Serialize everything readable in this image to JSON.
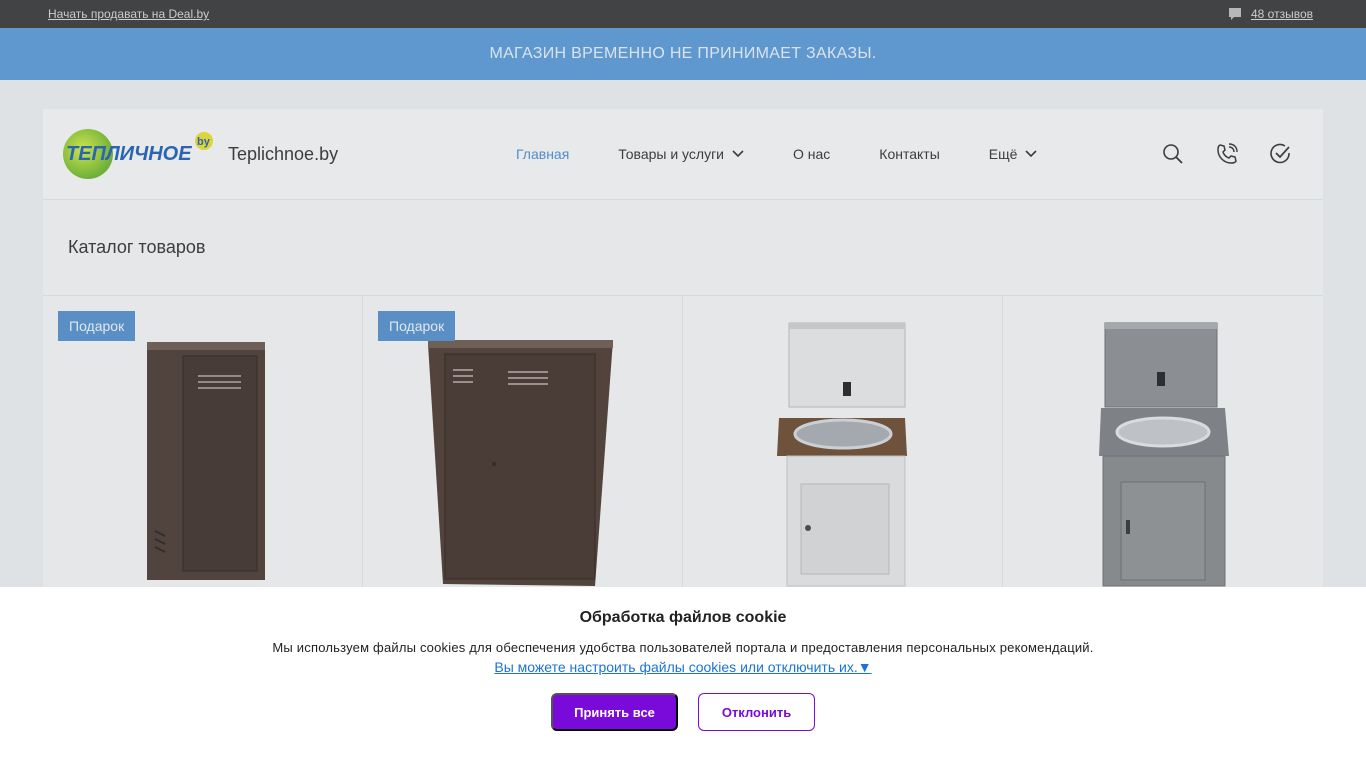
{
  "topbar": {
    "sell_link": "Начать продавать на Deal.by",
    "reviews": "48 отзывов",
    "reviews_icon": "comment-icon"
  },
  "notice": {
    "text": "МАГАЗИН ВРЕМЕННО НЕ ПРИНИМАЕТ ЗАКАЗЫ."
  },
  "header": {
    "logo_text": "ТЕПЛИЧНОЕ",
    "logo_suffix": "by",
    "site_name": "Teplichnoe.by",
    "nav": [
      {
        "label": "Главная",
        "active": true
      },
      {
        "label": "Товары и услуги",
        "dropdown": true
      },
      {
        "label": "О нас"
      },
      {
        "label": "Контакты"
      },
      {
        "label": "Ещё",
        "dropdown": true
      }
    ],
    "icons": [
      "search-icon",
      "phone-icon",
      "check-circle-icon"
    ]
  },
  "catalog": {
    "title": "Каталог товаров",
    "products": [
      {
        "badge": "Подарок",
        "image": "metal-cabinet-single"
      },
      {
        "badge": "Подарок",
        "image": "metal-cabinet-wide"
      },
      {
        "badge": "",
        "image": "washbasin-white"
      },
      {
        "badge": "",
        "image": "washbasin-steel"
      }
    ]
  },
  "cookie": {
    "title": "Обработка файлов cookie",
    "text": "Мы используем файлы cookies для обеспечения удобства пользователей портала и предоставления персональных рекомендаций.",
    "settings_link": "Вы можете настроить файлы cookies или отключить их.▼",
    "accept": "Принять все",
    "reject": "Отклонить"
  },
  "colors": {
    "accent": "#4a8fd0",
    "notice_bg": "#5a9ad8",
    "cookie_button": "#7a0ad9",
    "badge_bg": "#5590cc"
  }
}
